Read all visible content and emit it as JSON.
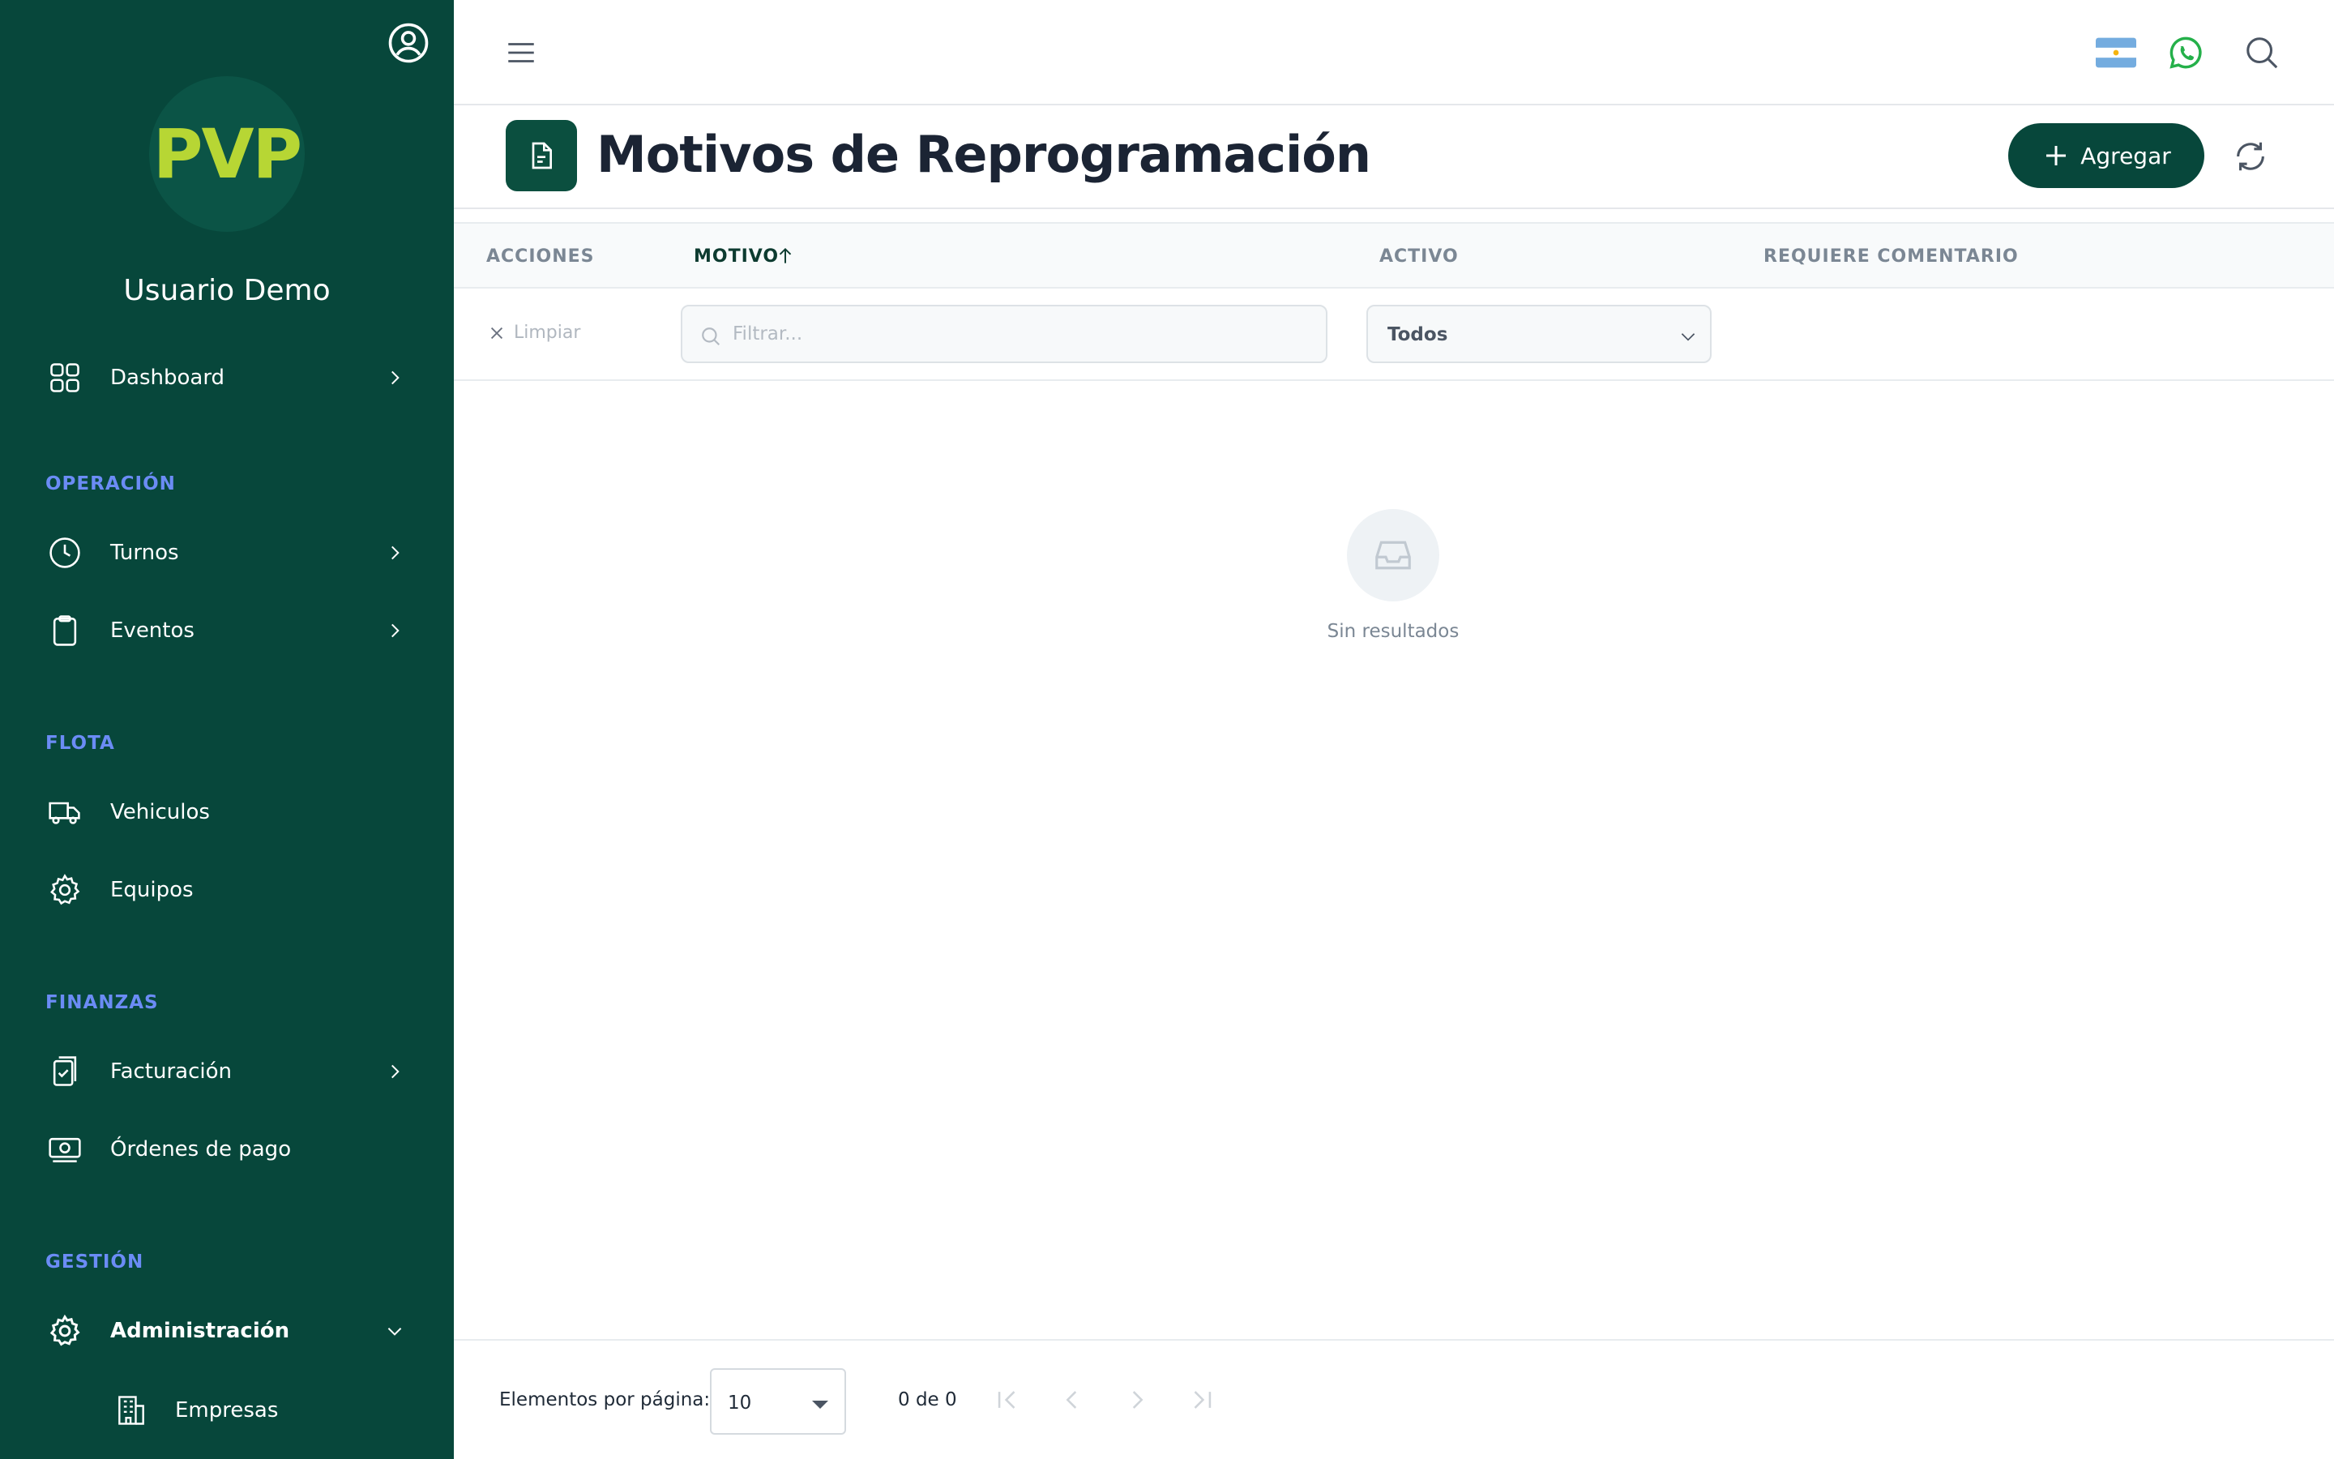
{
  "sidebar": {
    "logo": "PVP",
    "user_name": "Usuario Demo",
    "items": {
      "dashboard": "Dashboard",
      "turnos": "Turnos",
      "eventos": "Eventos",
      "vehiculos": "Vehiculos",
      "equipos": "Equipos",
      "facturacion": "Facturación",
      "ordenes": "Órdenes de pago",
      "administracion": "Administración",
      "empresas": "Empresas"
    },
    "sections": {
      "operacion": "OPERACIÓN",
      "flota": "FLOTA",
      "finanzas": "FINANZAS",
      "gestion": "GESTIÓN"
    }
  },
  "header": {
    "title": "Motivos de Reprogramación",
    "add_label": "Agregar"
  },
  "table": {
    "columns": [
      "ACCIONES",
      "MOTIVO",
      "ACTIVO",
      "REQUIERE COMENTARIO"
    ],
    "sorted_column": "MOTIVO",
    "sort_direction": "ascending",
    "clear_label": "Limpiar",
    "filter_placeholder": "Filtrar...",
    "activo_filter_value": "Todos",
    "empty_text": "Sin resultados"
  },
  "paginator": {
    "label": "Elementos por página:",
    "page_size": "10",
    "range": "0 de 0"
  },
  "colors": {
    "sidebar_bg": "#07473b",
    "accent": "#07473b",
    "logo": "#b7d634",
    "section_label": "#6b8cf5"
  }
}
